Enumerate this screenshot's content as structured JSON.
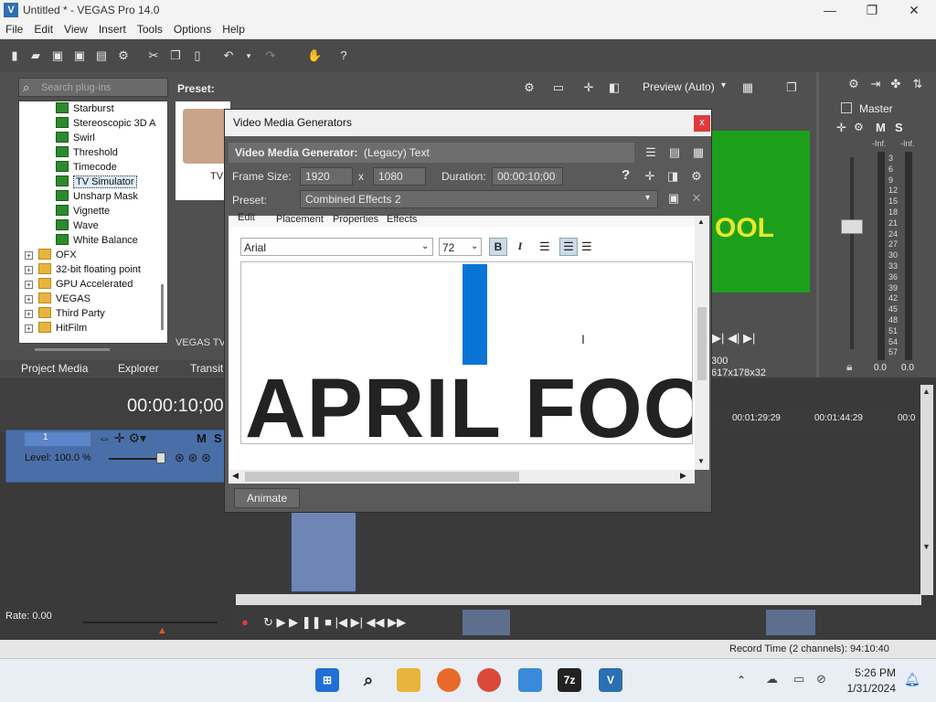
{
  "window": {
    "title": "Untitled * - VEGAS Pro 14.0",
    "app_icon": "vegas-icon",
    "minimize": "—",
    "maximize": "❐",
    "close": "✕"
  },
  "menu": [
    "File",
    "Edit",
    "View",
    "Insert",
    "Tools",
    "Options",
    "Help"
  ],
  "plugins": {
    "search_placeholder": "Search plug-ins",
    "preset_label": "Preset:",
    "items": [
      {
        "label": "Starburst",
        "type": "fx"
      },
      {
        "label": "Stereoscopic 3D A",
        "type": "fx"
      },
      {
        "label": "Swirl",
        "type": "fx"
      },
      {
        "label": "Threshold",
        "type": "fx"
      },
      {
        "label": "Timecode",
        "type": "fx"
      },
      {
        "label": "TV Simulator",
        "type": "fx",
        "selected": true
      },
      {
        "label": "Unsharp Mask",
        "type": "fx"
      },
      {
        "label": "Vignette",
        "type": "fx"
      },
      {
        "label": "Wave",
        "type": "fx"
      },
      {
        "label": "White Balance",
        "type": "fx"
      },
      {
        "label": "OFX",
        "type": "folder"
      },
      {
        "label": "32-bit floating point",
        "type": "folder"
      },
      {
        "label": "GPU Accelerated",
        "type": "folder"
      },
      {
        "label": "VEGAS",
        "type": "folder"
      },
      {
        "label": "Third Party",
        "type": "folder"
      },
      {
        "label": "HitFilm",
        "type": "folder"
      }
    ],
    "thumb_label": "TV",
    "footer_label": "VEGAS TV S"
  },
  "tabs": [
    "Project Media",
    "Explorer",
    "Transiti"
  ],
  "preview": {
    "mode": "Preview (Auto)",
    "overlay_text": "OOL",
    "frame_num": "300",
    "res": "617x178x32"
  },
  "master": {
    "title": "Master",
    "m": "M",
    "s": "S",
    "inf_left": "-Inf.",
    "inf_right": "-Inf.",
    "scale": [
      "3",
      "6",
      "9",
      "12",
      "15",
      "18",
      "21",
      "24",
      "27",
      "30",
      "33",
      "36",
      "39",
      "42",
      "45",
      "48",
      "51",
      "54",
      "57"
    ],
    "val_left": "0.0",
    "val_right": "0.0"
  },
  "dialog": {
    "title": "Video Media Generators",
    "close": "x",
    "generator_label": "Video Media Generator:",
    "generator_value": "(Legacy) Text",
    "frame_size_label": "Frame Size:",
    "width": "1920",
    "x": "x",
    "height": "1080",
    "duration_label": "Duration:",
    "duration": "00:00:10;00",
    "help": "?",
    "preset_label": "Preset:",
    "preset_value": "Combined Effects 2",
    "tabs": [
      "Edit",
      "Placement",
      "Properties",
      "Effects"
    ],
    "font": "Arial",
    "size": "72",
    "bold": "B",
    "italic": "I",
    "text": "APRIL FOO",
    "animate": "Animate"
  },
  "timeline": {
    "timecode": "00:00:10;00",
    "track_num": "1",
    "level": "Level: 100.0 %",
    "m": "M",
    "s": "S",
    "ruler": [
      "00:01:29:29",
      "00:01:44:29",
      "00:0"
    ],
    "rate": "Rate: 0.00",
    "record_time": "Record Time (2 channels): 94:10:40"
  },
  "taskbar": {
    "time": "5:26 PM",
    "date": "1/31/2024",
    "apps": [
      "windows-start-icon",
      "search-icon",
      "file-explorer-icon",
      "firefox-icon",
      "chrome-icon",
      "photos-icon",
      "7zip-icon",
      "vegas-icon"
    ],
    "seven_zip": "7z"
  }
}
